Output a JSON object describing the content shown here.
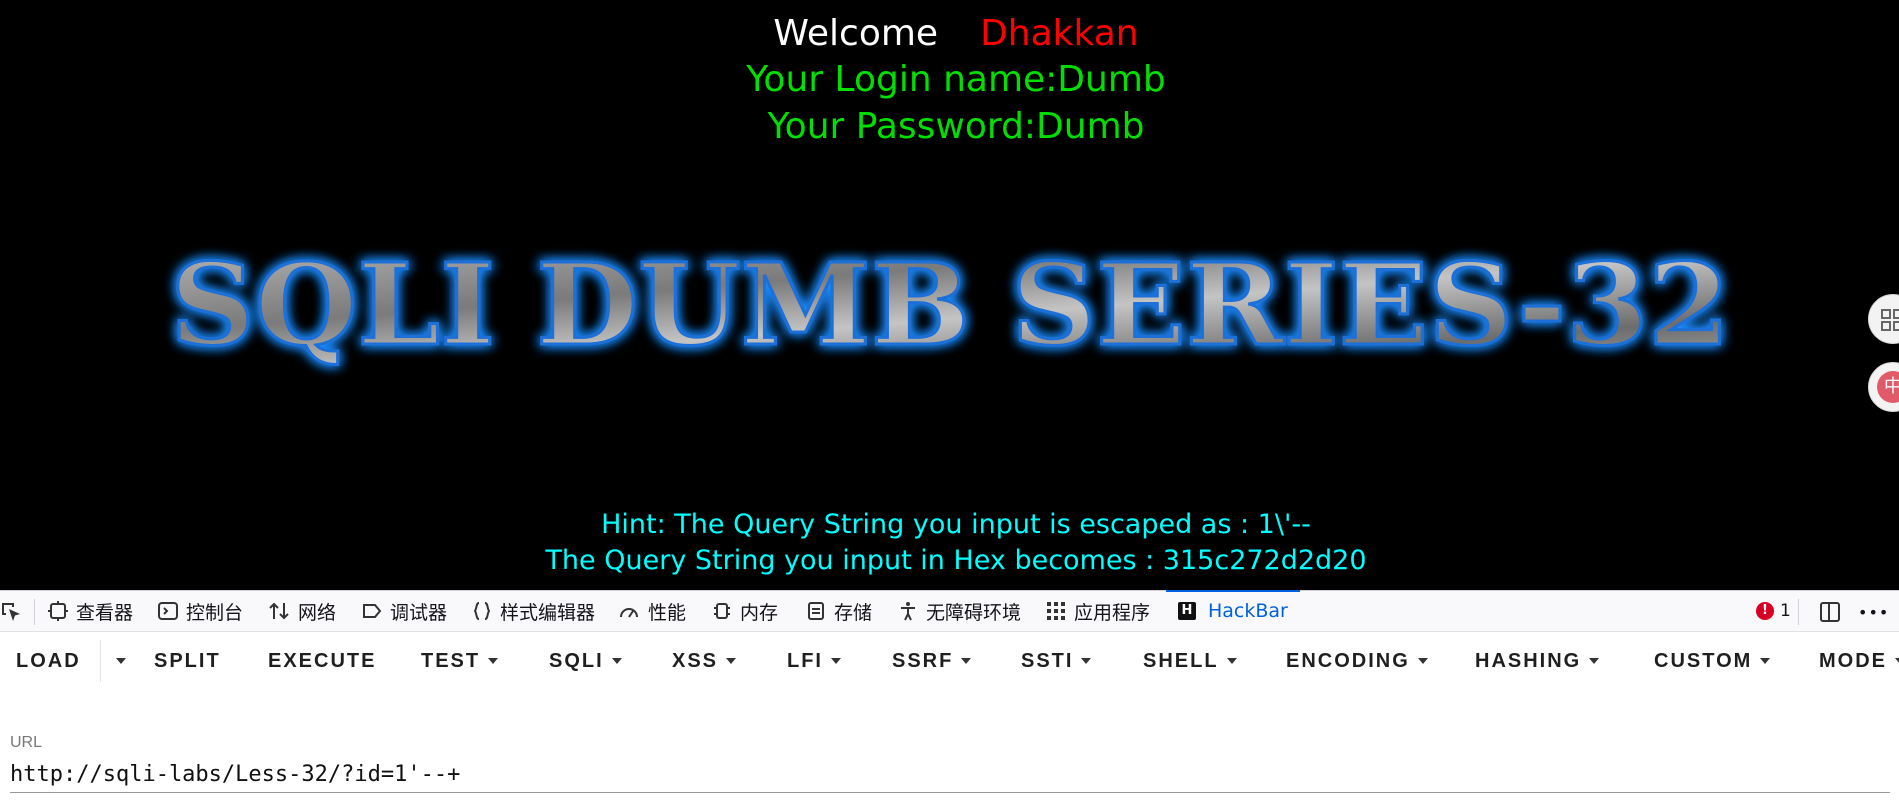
{
  "page": {
    "welcome_word": "Welcome",
    "welcome_name": "Dhakkan",
    "login_line": "Your Login name:Dumb",
    "password_line": "Your Password:Dumb",
    "logo_text": "SQLI DUMB SERIES-32",
    "hint_line": "Hint: The Query String you input is escaped as : 1\\'--",
    "hex_line": "The Query String you input in Hex becomes : 315c272d2d20",
    "side_button_cn": "中"
  },
  "devtools": {
    "tabs": [
      {
        "label": "查看器",
        "icon": "inspector-icon"
      },
      {
        "label": "控制台",
        "icon": "console-icon"
      },
      {
        "label": "网络",
        "icon": "network-icon"
      },
      {
        "label": "调试器",
        "icon": "debugger-icon"
      },
      {
        "label": "样式编辑器",
        "icon": "style-editor-icon"
      },
      {
        "label": "性能",
        "icon": "performance-icon"
      },
      {
        "label": "内存",
        "icon": "memory-icon"
      },
      {
        "label": "存储",
        "icon": "storage-icon"
      },
      {
        "label": "无障碍环境",
        "icon": "accessibility-icon"
      },
      {
        "label": "应用程序",
        "icon": "application-icon"
      },
      {
        "label": "HackBar",
        "icon": "hackbar-icon"
      }
    ],
    "active_tab": "HackBar",
    "hackbar_icon_letter": "H",
    "error_count": "1",
    "error_icon": "!",
    "more_icon": "•••"
  },
  "hackbar": {
    "buttons": [
      {
        "label": "LOAD",
        "dropdown": false
      },
      {
        "label": "SPLIT",
        "dropdown": false
      },
      {
        "label": "EXECUTE",
        "dropdown": false
      },
      {
        "label": "TEST",
        "dropdown": true
      },
      {
        "label": "SQLI",
        "dropdown": true
      },
      {
        "label": "XSS",
        "dropdown": true
      },
      {
        "label": "LFI",
        "dropdown": true
      },
      {
        "label": "SSRF",
        "dropdown": true
      },
      {
        "label": "SSTI",
        "dropdown": true
      },
      {
        "label": "SHELL",
        "dropdown": true
      },
      {
        "label": "ENCODING",
        "dropdown": true
      },
      {
        "label": "HASHING",
        "dropdown": true
      },
      {
        "label": "CUSTOM",
        "dropdown": true
      },
      {
        "label": "MODE",
        "dropdown": true
      }
    ],
    "url_label": "URL",
    "url_value": "http://sqli-labs/Less-32/?id=1'--+"
  },
  "colors": {
    "welcome_name": "#ff0000",
    "login_text": "#00e000",
    "hint_text": "#00ffff",
    "logo_glow": "#1e8cff",
    "active_tab": "#0061e0"
  }
}
